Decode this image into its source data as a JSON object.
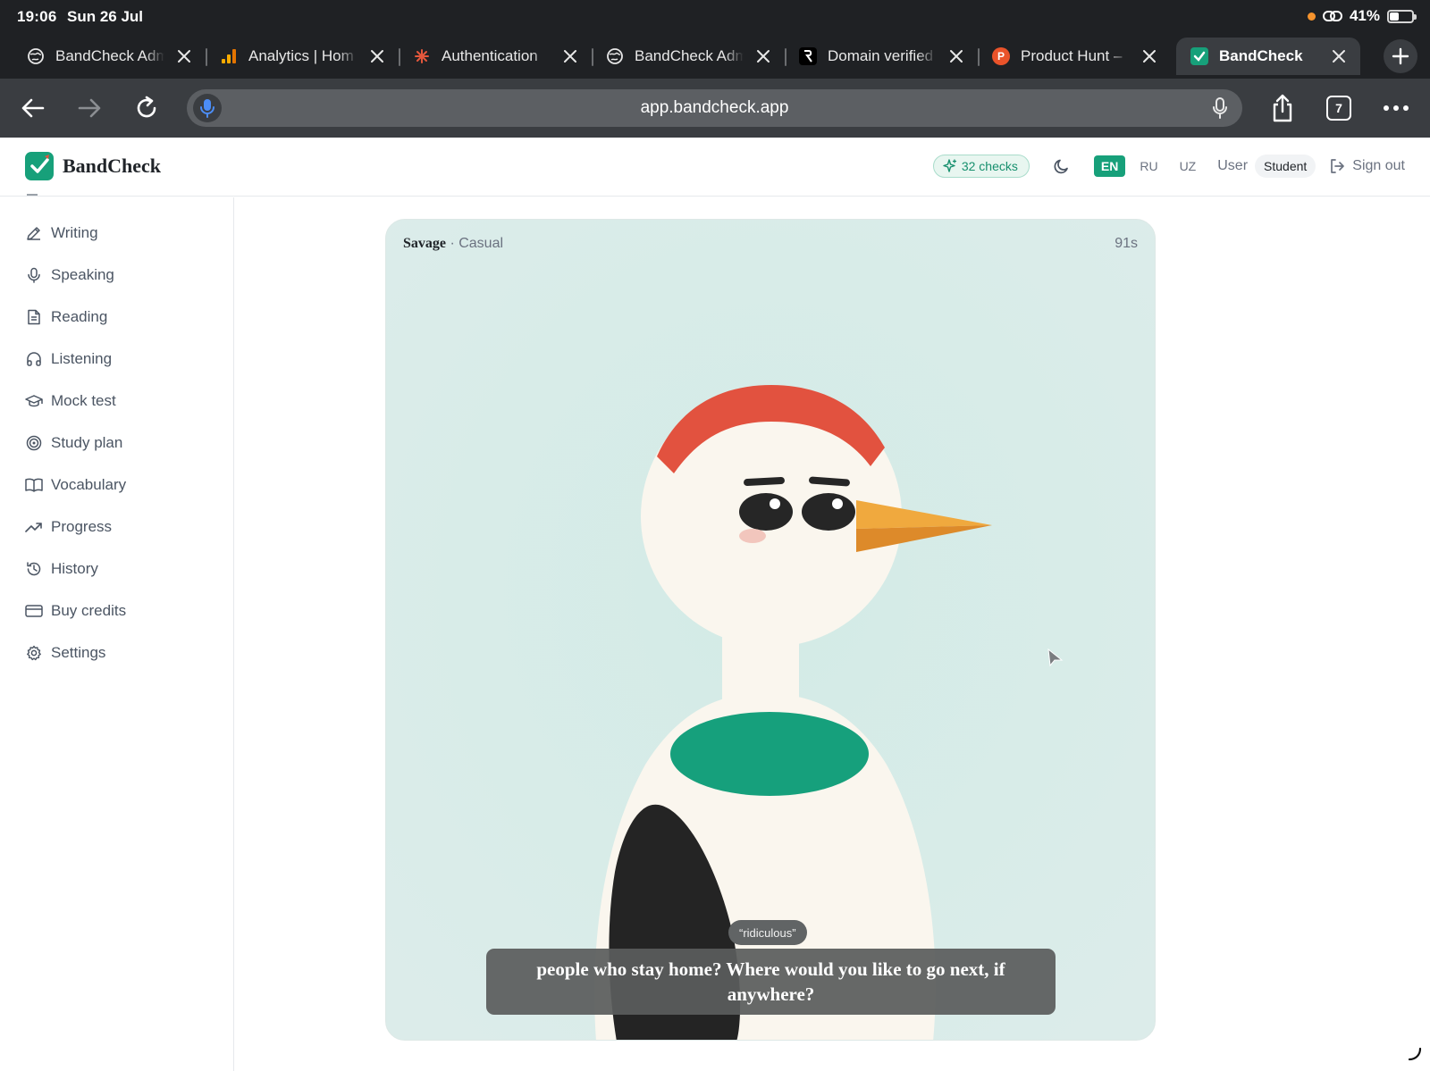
{
  "status": {
    "time": "19:06",
    "date": "Sun 26 Jul",
    "battery": "41%"
  },
  "tabs": [
    {
      "title": "BandCheck Adm",
      "favicon": "globe-icon",
      "active": false
    },
    {
      "title": "Analytics | Hom",
      "favicon": "analytics-icon",
      "active": false
    },
    {
      "title": "Authentication",
      "favicon": "spark-icon",
      "active": false
    },
    {
      "title": "BandCheck Adm",
      "favicon": "globe-icon",
      "active": false
    },
    {
      "title": "Domain verified",
      "favicon": "resend-icon",
      "active": false
    },
    {
      "title": "Product Hunt –",
      "favicon": "product-hunt-icon",
      "active": false
    },
    {
      "title": "BandCheck",
      "favicon": "bandcheck-icon",
      "active": true
    }
  ],
  "toolbar": {
    "url": "app.bandcheck.app",
    "tab_count": "7"
  },
  "header": {
    "brand": "BandCheck",
    "checks_label": "32 checks",
    "languages": [
      "EN",
      "RU",
      "UZ"
    ],
    "active_language": "EN",
    "user_label": "User",
    "role_label": "Student",
    "sign_out_label": "Sign out"
  },
  "sidebar": {
    "items": [
      {
        "label": "Writing",
        "icon": "pencil-icon"
      },
      {
        "label": "Speaking",
        "icon": "microphone-icon"
      },
      {
        "label": "Reading",
        "icon": "document-icon"
      },
      {
        "label": "Listening",
        "icon": "headphones-icon"
      },
      {
        "label": "Mock test",
        "icon": "graduation-cap-icon"
      },
      {
        "label": "Study plan",
        "icon": "target-icon"
      },
      {
        "label": "Vocabulary",
        "icon": "book-icon"
      },
      {
        "label": "Progress",
        "icon": "trend-up-icon"
      },
      {
        "label": "History",
        "icon": "history-icon"
      },
      {
        "label": "Buy credits",
        "icon": "credit-card-icon"
      },
      {
        "label": "Settings",
        "icon": "gear-icon"
      }
    ]
  },
  "session": {
    "persona_name": "Savage",
    "persona_style": "Casual",
    "timer": "91s",
    "highlight_word": "“ridiculous”",
    "caption": "people who stay home? Where would you like to go next, if anywhere?"
  },
  "colors": {
    "accent": "#17a07a",
    "card_background": "#d9ece9",
    "bird_crest": "#e2523f",
    "bird_beak": "#f0a93e",
    "bird_collar": "#16a07c"
  }
}
